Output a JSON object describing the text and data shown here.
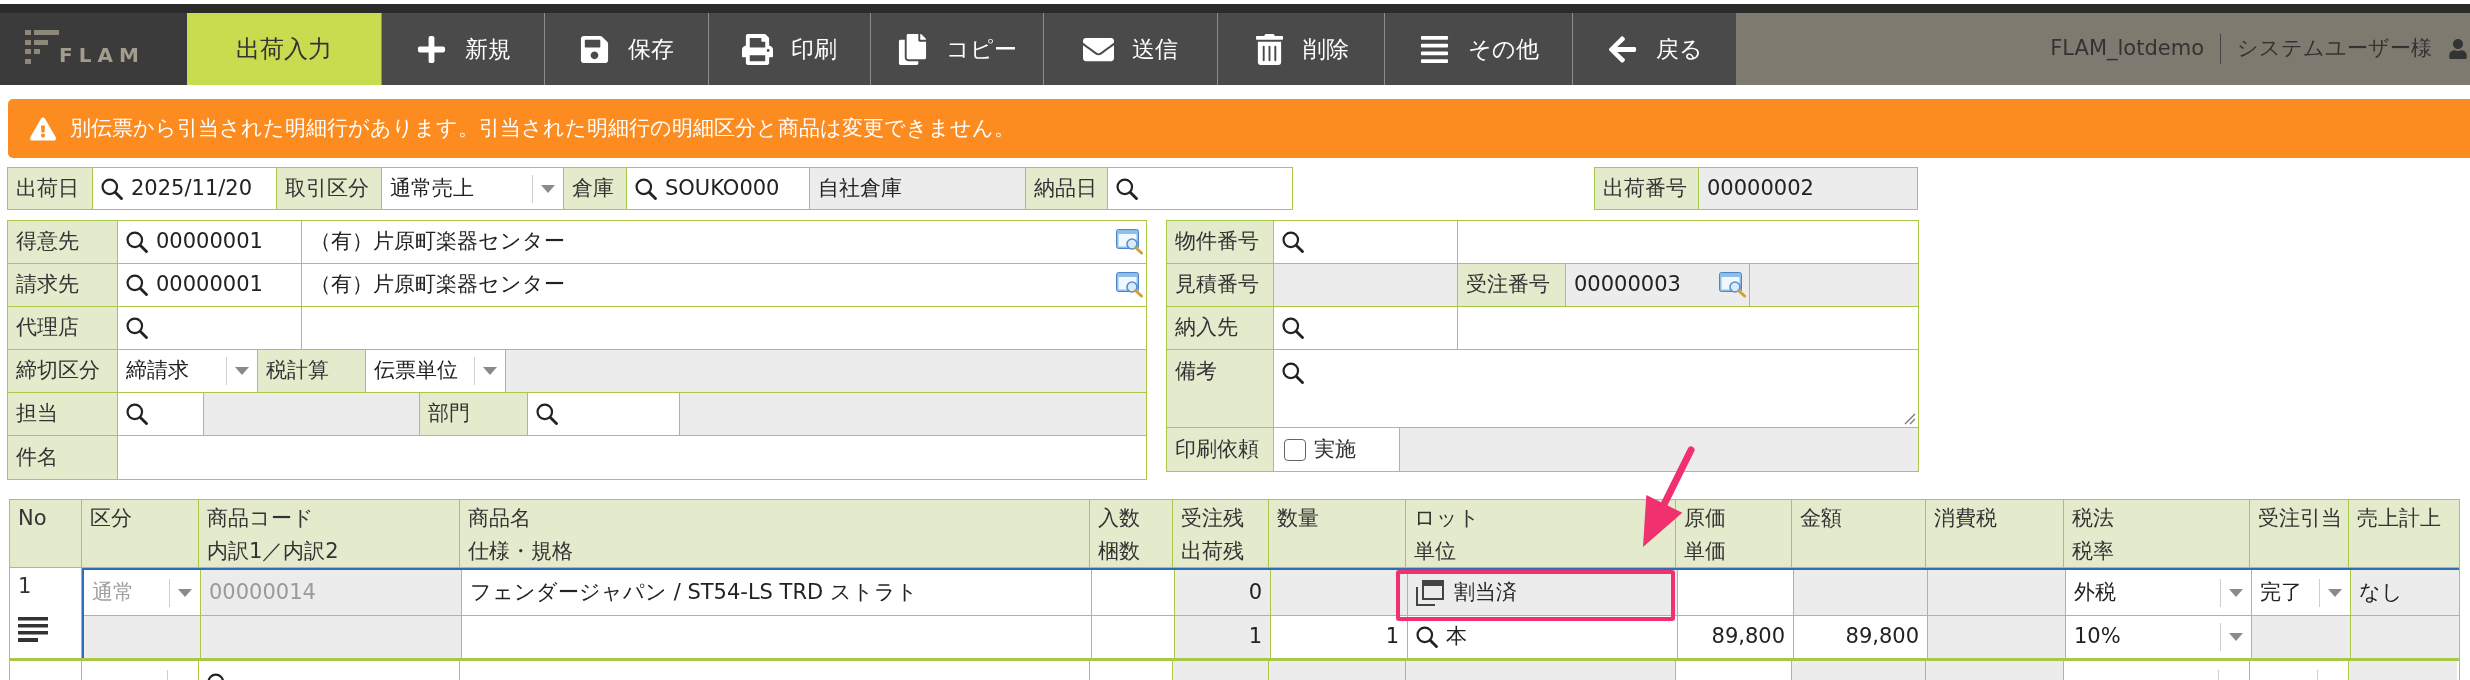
{
  "toolbar": {
    "logo": "FLAM",
    "tabs": [
      {
        "label": "出荷入力",
        "selected": true
      }
    ],
    "buttons": [
      "新規",
      "保存",
      "印刷",
      "コピー",
      "送信",
      "削除",
      "その他",
      "戻る"
    ]
  },
  "user_bar": {
    "company": "FLAM_lotdemo",
    "user": "システムユーザー様"
  },
  "alert": {
    "message": "別伝票から引当された明細行があります。引当された明細行の明細区分と商品は変更できません。"
  },
  "header": {
    "shipping_date": {
      "label": "出荷日",
      "value": "2025/11/20"
    },
    "transaction_type": {
      "label": "取引区分",
      "value": "通常売上"
    },
    "warehouse": {
      "label": "倉庫",
      "code": "SOUKO000",
      "name": "自社倉庫"
    },
    "delivery_date": {
      "label": "納品日"
    },
    "shipping_number": {
      "label": "出荷番号",
      "value": "00000002"
    }
  },
  "customer_panel": {
    "customer": {
      "label": "得意先",
      "code": "00000001",
      "name": "（有）片原町楽器センター"
    },
    "billing": {
      "label": "請求先",
      "code": "00000001",
      "name": "（有）片原町楽器センター"
    },
    "agent": {
      "label": "代理店"
    },
    "closing_type": {
      "label": "締切区分",
      "value": "締請求"
    },
    "tax_calculation": {
      "label": "税計算",
      "value": "伝票単位"
    },
    "staff": {
      "label": "担当"
    },
    "department": {
      "label": "部門"
    },
    "subject": {
      "label": "件名"
    }
  },
  "order_panel": {
    "project_number": {
      "label": "物件番号"
    },
    "estimate_number": {
      "label": "見積番号"
    },
    "order_number": {
      "label": "受注番号",
      "value": "00000003"
    },
    "delivery_destination": {
      "label": "納入先"
    },
    "remarks": {
      "label": "備考"
    },
    "print_request": {
      "label": "印刷依頼",
      "option": "実施",
      "checked": false
    }
  },
  "table": {
    "columns": [
      {
        "label": "No"
      },
      {
        "label": "区分"
      },
      {
        "label": "商品コード",
        "sub_label": "内訳1／内訳2"
      },
      {
        "label": "商品名",
        "sub_label": "仕様・規格"
      },
      {
        "label": "入数",
        "sub_label": "梱数"
      },
      {
        "label": "受注残",
        "sub_label": "出荷残"
      },
      {
        "label": "数量"
      },
      {
        "label": "ロット",
        "sub_label": "単位"
      },
      {
        "label": "原価",
        "sub_label": "単価"
      },
      {
        "label": "金額"
      },
      {
        "label": "消費税"
      },
      {
        "label": "税法",
        "sub_label": "税率"
      },
      {
        "label": "受注引当"
      },
      {
        "label": "売上計上"
      }
    ],
    "rows": [
      {
        "no": "1",
        "selected": true,
        "category": {
          "value": "通常",
          "disabled": true
        },
        "product_code": "00000014",
        "product_name": "フェンダージャパン / ST54-LS TRD ストラト",
        "order_remaining": "0",
        "shipping_remaining": "1",
        "quantity": "1",
        "lot": {
          "status": "割当済",
          "annotated": true
        },
        "unit": "本",
        "unit_price": "89,800",
        "amount": "89,800",
        "tax_type": "外税",
        "tax_rate": "10%",
        "order_allocation": "完了",
        "sales_posting": "なし"
      },
      {
        "selected": false,
        "category": {
          "disabled": false
        }
      }
    ]
  }
}
